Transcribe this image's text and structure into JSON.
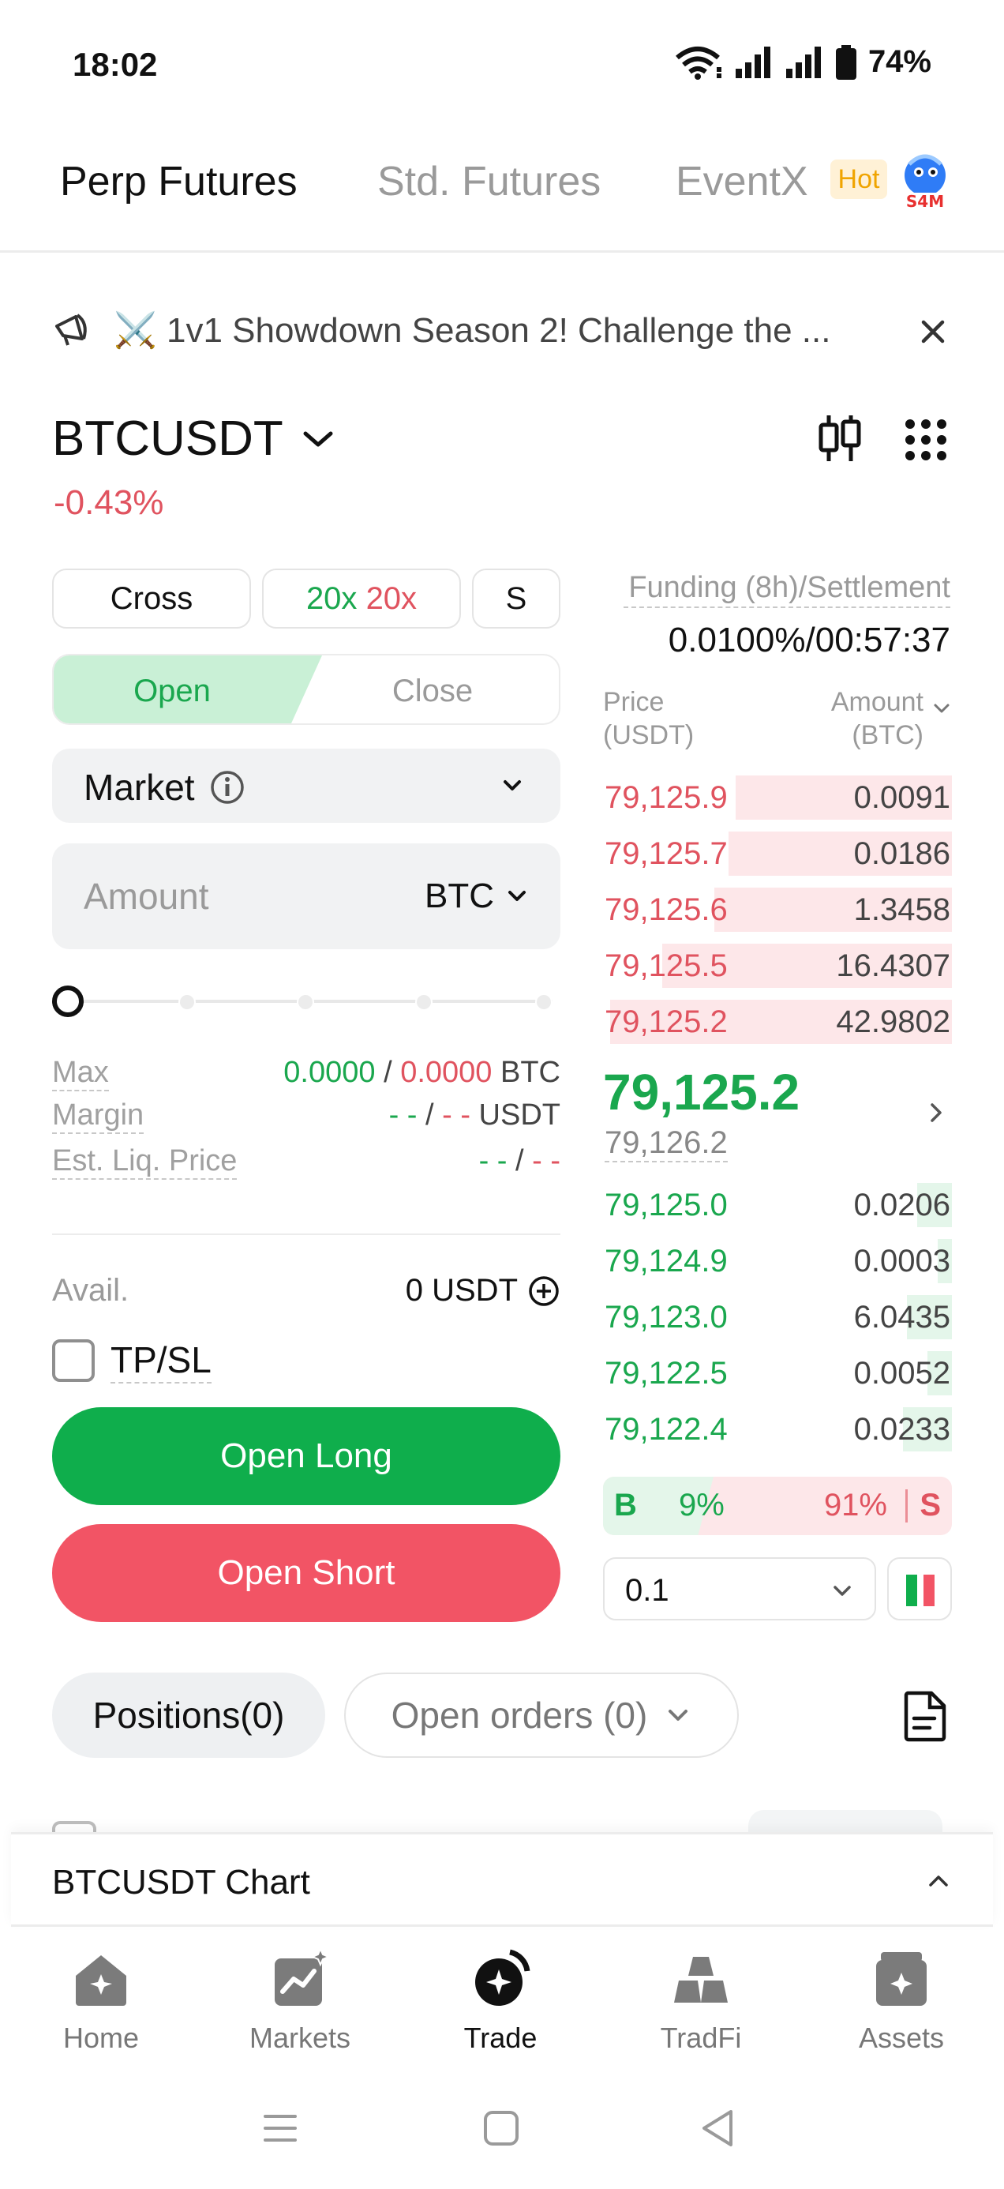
{
  "status": {
    "time": "18:02",
    "battery": "74%"
  },
  "top_tabs": [
    {
      "label": "Perp Futures",
      "active": true
    },
    {
      "label": "Std. Futures",
      "active": false
    },
    {
      "label": "EventX",
      "active": false
    }
  ],
  "hot_badge": "Hot",
  "announcement": "⚔️ 1v1 Showdown Season 2! Challenge the ...",
  "symbol": {
    "name": "BTCUSDT",
    "change": "-0.43%"
  },
  "margin_mode": "Cross",
  "leverage": {
    "long": "20x",
    "short": "20x"
  },
  "position_mode": "S",
  "order_side": {
    "open": "Open",
    "close": "Close"
  },
  "order_type": "Market",
  "amount": {
    "placeholder": "Amount",
    "unit": "BTC"
  },
  "info": {
    "max_label": "Max",
    "max_long": "0.0000",
    "max_sep": " / ",
    "max_short": "0.0000",
    "max_unit": " BTC",
    "margin_label": "Margin",
    "margin_long": "- -",
    "margin_sep": " / ",
    "margin_short": "- -",
    "margin_unit": " USDT",
    "liq_label": "Est. Liq. Price",
    "liq_long": "- -",
    "liq_sep": " / ",
    "liq_short": "- -"
  },
  "avail": {
    "label": "Avail.",
    "value": "0 USDT"
  },
  "tpsl": "TP/SL",
  "buttons": {
    "long": "Open Long",
    "short": "Open Short"
  },
  "funding": {
    "label": "Funding (8h)/Settlement",
    "value": "0.0100%/00:57:37"
  },
  "orderbook": {
    "price_header": [
      "Price",
      "(USDT)"
    ],
    "amount_header": [
      "Amount",
      "(BTC)"
    ],
    "asks": [
      {
        "price": "79,125.9",
        "amount": "0.0091",
        "depth": 0.62
      },
      {
        "price": "79,125.7",
        "amount": "0.0186",
        "depth": 0.64
      },
      {
        "price": "79,125.6",
        "amount": "1.3458",
        "depth": 0.68
      },
      {
        "price": "79,125.5",
        "amount": "16.4307",
        "depth": 0.83
      },
      {
        "price": "79,125.2",
        "amount": "42.9802",
        "depth": 0.98
      }
    ],
    "last_price": "79,125.2",
    "mark_price": "79,126.2",
    "bids": [
      {
        "price": "79,125.0",
        "amount": "0.0206",
        "depth": 0.1
      },
      {
        "price": "79,124.9",
        "amount": "0.0003",
        "depth": 0.04
      },
      {
        "price": "79,123.0",
        "amount": "6.0435",
        "depth": 0.13
      },
      {
        "price": "79,122.5",
        "amount": "0.0052",
        "depth": 0.07
      },
      {
        "price": "79,122.4",
        "amount": "0.0233",
        "depth": 0.14
      }
    ],
    "buy_label": "B",
    "buy_pct": "9%",
    "sell_pct": "91%",
    "sell_label": "S",
    "precision": "0.1"
  },
  "position_tabs": {
    "positions": "Positions(0)",
    "orders": "Open orders (0)"
  },
  "chart_bar": "BTCUSDT Chart",
  "nav": [
    {
      "label": "Home",
      "icon": "home-icon",
      "active": false
    },
    {
      "label": "Markets",
      "icon": "markets-icon",
      "active": false
    },
    {
      "label": "Trade",
      "icon": "trade-icon",
      "active": true
    },
    {
      "label": "TradFi",
      "icon": "tradfi-icon",
      "active": false
    },
    {
      "label": "Assets",
      "icon": "assets-icon",
      "active": false
    }
  ],
  "colors": {
    "green": "#0fae4c",
    "red": "#f25465",
    "price_green": "#1aa74e",
    "price_red": "#e0535f"
  }
}
